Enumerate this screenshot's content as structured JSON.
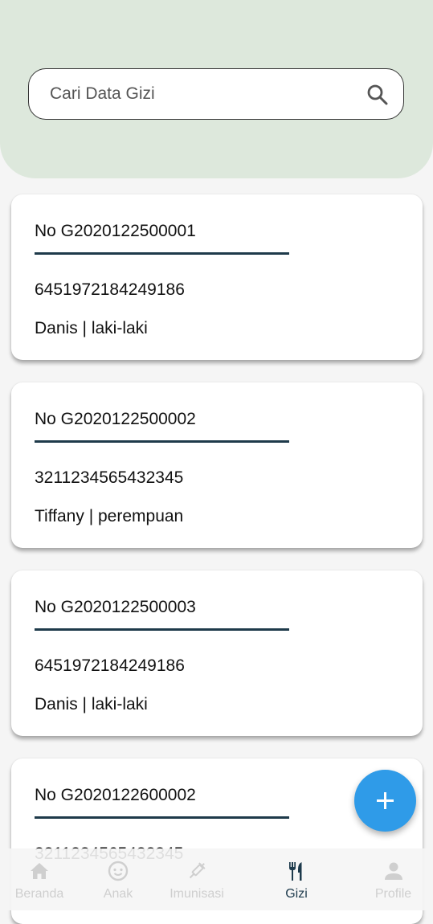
{
  "search": {
    "placeholder": "Cari Data Gizi",
    "icon": "search-icon"
  },
  "records": [
    {
      "no": "No G2020122500001",
      "nik": "6451972184249186",
      "info": "Danis | laki-laki"
    },
    {
      "no": "No G2020122500002",
      "nik": "3211234565432345",
      "info": "Tiffany | perempuan"
    },
    {
      "no": "No G2020122500003",
      "nik": "6451972184249186",
      "info": "Danis | laki-laki"
    },
    {
      "no": "No G2020122600002",
      "nik": "3211234565432345",
      "info": ""
    }
  ],
  "fab": {
    "icon": "plus-icon"
  },
  "nav": {
    "items": [
      {
        "label": "Beranda",
        "icon": "home-icon",
        "active": false
      },
      {
        "label": "Anak",
        "icon": "baby-face-icon",
        "active": false
      },
      {
        "label": "Imunisasi",
        "icon": "syringe-icon",
        "active": false
      },
      {
        "label": "Gizi",
        "icon": "fork-knife-icon",
        "active": true
      },
      {
        "label": "Profile",
        "icon": "person-icon",
        "active": false
      }
    ]
  },
  "colors": {
    "header_bg": "#dde8dc",
    "divider": "#1e3a4a",
    "fab": "#2f9be8",
    "nav_active": "#1d3a4c",
    "nav_inactive": "#cfcfcf"
  }
}
